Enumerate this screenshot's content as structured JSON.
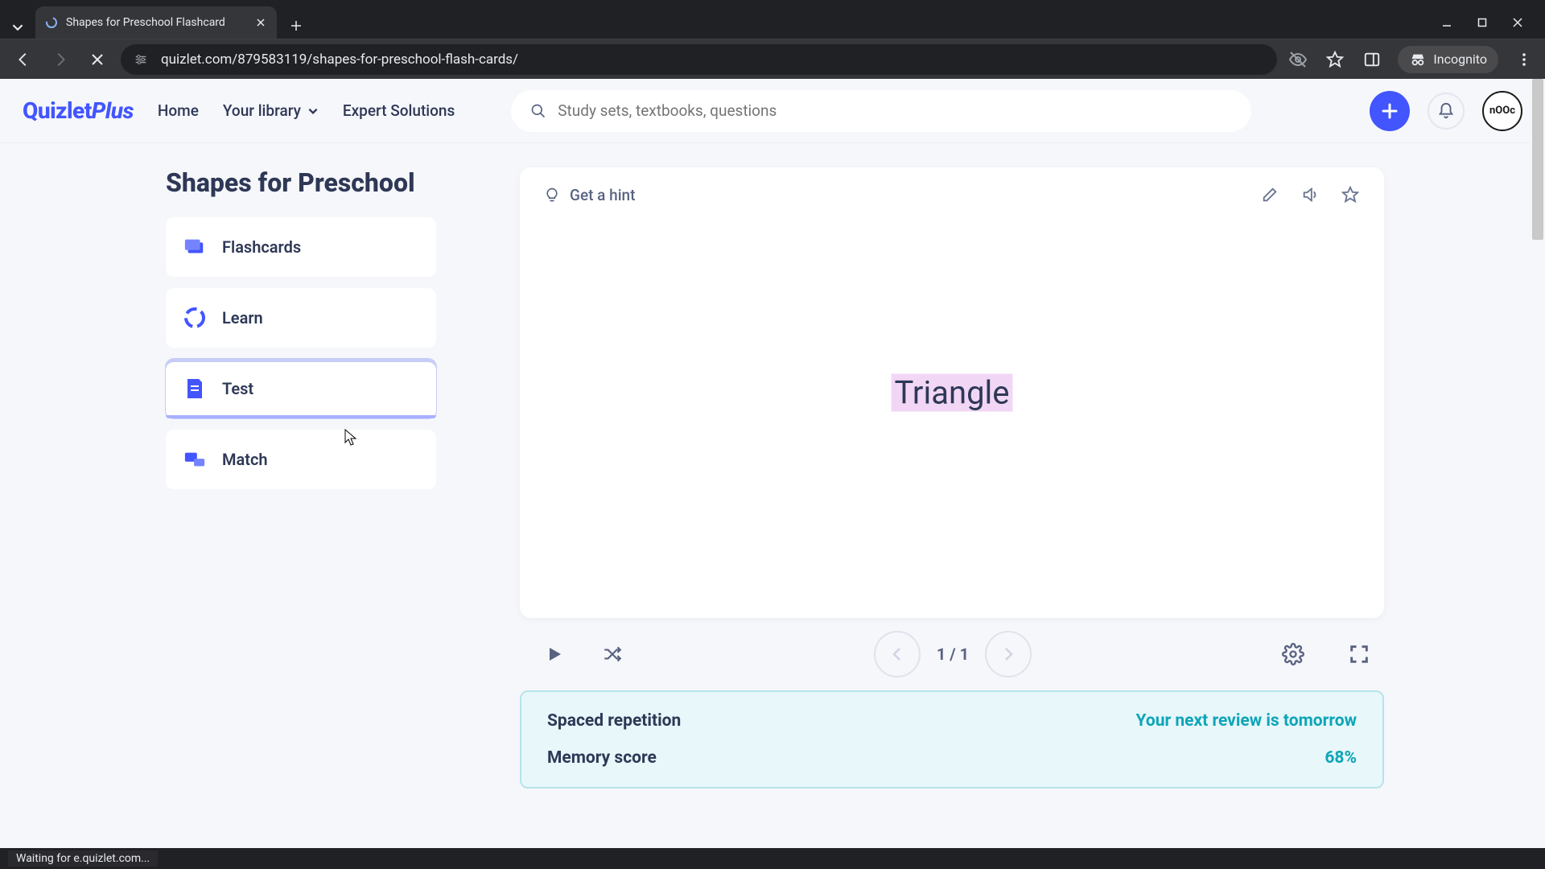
{
  "browser": {
    "tab_title": "Shapes for Preschool Flashcard",
    "url": "quizlet.com/879583119/shapes-for-preschool-flash-cards/",
    "incognito_label": "Incognito",
    "status_text": "Waiting for e.quizlet.com..."
  },
  "header": {
    "logo_main": "Quizlet",
    "logo_suffix": "Plus",
    "nav_home": "Home",
    "nav_library": "Your library",
    "nav_expert": "Expert Solutions",
    "search_placeholder": "Study sets, textbooks, questions",
    "avatar_text": "nOOc"
  },
  "set": {
    "title": "Shapes for Preschool",
    "modes": [
      {
        "label": "Flashcards"
      },
      {
        "label": "Learn"
      },
      {
        "label": "Test"
      },
      {
        "label": "Match"
      }
    ]
  },
  "card": {
    "hint_label": "Get a hint",
    "term": "Triangle"
  },
  "pager": {
    "label": "1 / 1"
  },
  "spaced_rep": {
    "title": "Spaced repetition",
    "next_review": "Your next review is tomorrow",
    "memory_label": "Memory score",
    "memory_value": "68%"
  }
}
